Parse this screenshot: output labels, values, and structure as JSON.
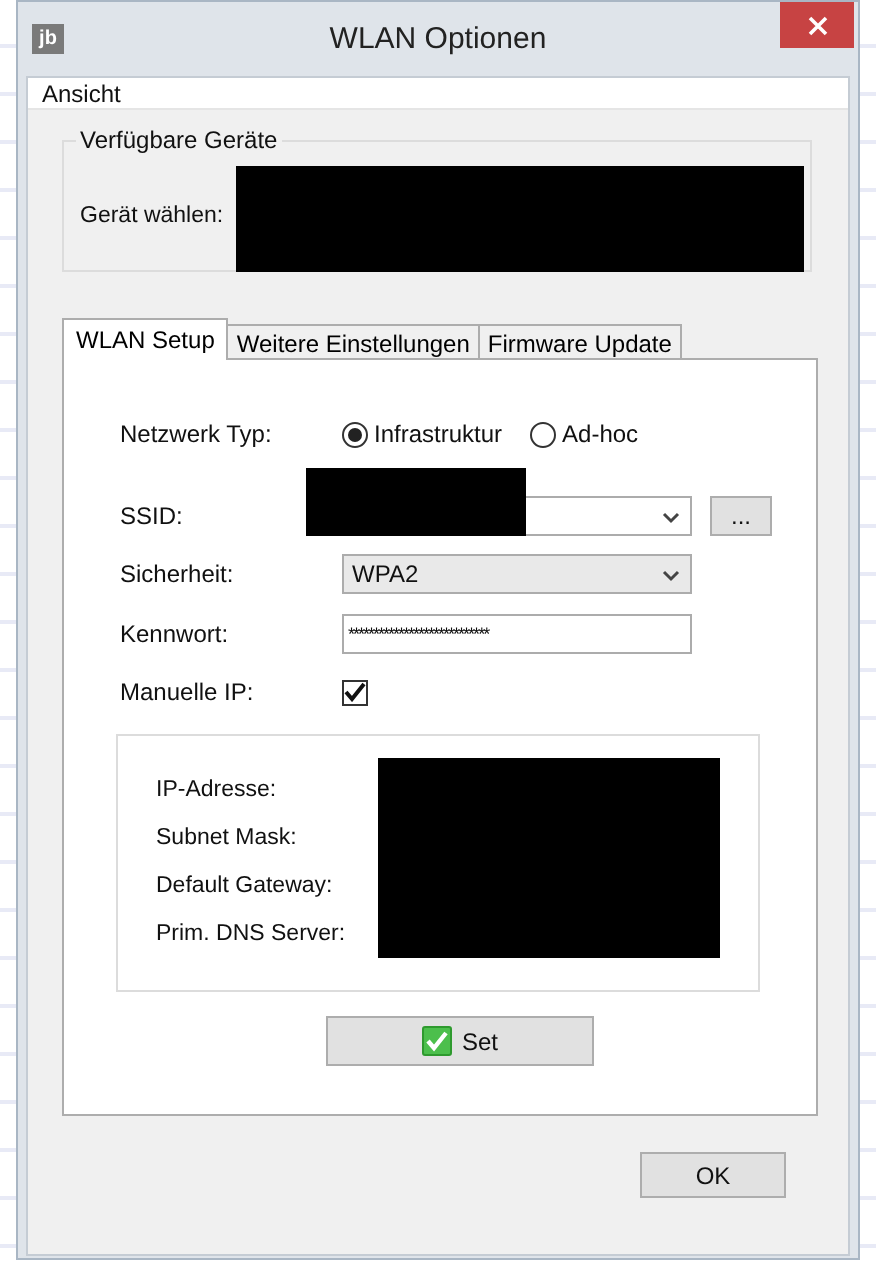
{
  "window": {
    "title": "WLAN Optionen",
    "app_icon_text": "jb"
  },
  "menu": [
    "Ansicht"
  ],
  "devices_group": {
    "title": "Verfügbare Geräte",
    "label": "Gerät wählen:"
  },
  "tabs": [
    {
      "label": "WLAN Setup",
      "selected": true
    },
    {
      "label": "Weitere Einstellungen",
      "selected": false
    },
    {
      "label": "Firmware Update",
      "selected": false
    }
  ],
  "network_type": {
    "label": "Netzwerk Typ:",
    "options": [
      {
        "label": "Infrastruktur",
        "selected": true
      },
      {
        "label": "Ad-hoc",
        "selected": false
      }
    ]
  },
  "ssid": {
    "label": "SSID:",
    "browse_button": "..."
  },
  "security": {
    "label": "Sicherheit:",
    "value": "WPA2"
  },
  "password": {
    "label": "Kennwort:",
    "value": "****************************"
  },
  "manual_ip": {
    "label": "Manuelle IP:",
    "checked": true
  },
  "ip_fields": [
    "IP-Adresse:",
    "Subnet Mask:",
    "Default Gateway:",
    "Prim. DNS Server:"
  ],
  "set_button": "Set",
  "ok_button": "OK"
}
